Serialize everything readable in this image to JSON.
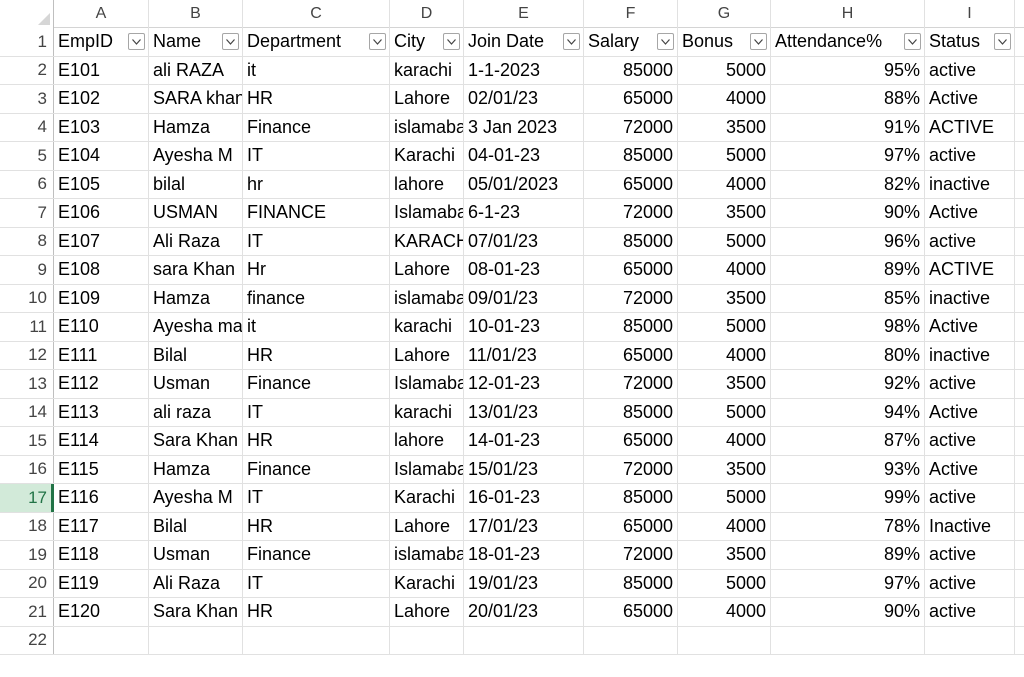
{
  "columns": [
    "A",
    "B",
    "C",
    "D",
    "E",
    "F",
    "G",
    "H",
    "I"
  ],
  "row_numbers": [
    "1",
    "2",
    "3",
    "4",
    "5",
    "6",
    "7",
    "8",
    "9",
    "10",
    "11",
    "12",
    "13",
    "14",
    "15",
    "16",
    "17",
    "18",
    "19",
    "20",
    "21",
    "22"
  ],
  "headers": [
    "EmpID",
    "Name",
    "Department",
    "City",
    "Join Date",
    "Salary",
    "Bonus",
    "Attendance%",
    "Status"
  ],
  "rows": [
    [
      "E101",
      "ali RAZA",
      "it",
      "karachi",
      "1-1-2023",
      "85000",
      "5000",
      "95%",
      "active"
    ],
    [
      "E102",
      " SARA khan",
      "HR",
      "Lahore",
      "02/01/23",
      "65000",
      "4000",
      "88%",
      "Active"
    ],
    [
      "E103",
      "Hamza",
      "Finance",
      "islamabad",
      "3 Jan 2023",
      "72000",
      "3500",
      "91%",
      "ACTIVE"
    ],
    [
      "E104",
      "Ayesha M",
      "IT",
      "Karachi",
      "04-01-23",
      "85000",
      "5000",
      "97%",
      "active"
    ],
    [
      "E105",
      "bilal",
      "hr",
      "lahore",
      "05/01/2023",
      "65000",
      "4000",
      "82%",
      "inactive"
    ],
    [
      "E106",
      "USMAN",
      "FINANCE",
      "Islamabad",
      "6-1-23",
      "72000",
      "3500",
      "90%",
      "Active"
    ],
    [
      "E107",
      "Ali Raza",
      "IT",
      "KARACHI",
      "07/01/23",
      "85000",
      "5000",
      "96%",
      "active"
    ],
    [
      "E108",
      "sara Khan",
      "Hr",
      "Lahore",
      "08-01-23",
      "65000",
      "4000",
      "89%",
      "ACTIVE"
    ],
    [
      "E109",
      "Hamza",
      "finance",
      "islamabad",
      "09/01/23",
      "72000",
      "3500",
      "85%",
      "inactive"
    ],
    [
      "E110",
      "Ayesha malik",
      "it",
      "karachi",
      "10-01-23",
      "85000",
      "5000",
      "98%",
      "Active"
    ],
    [
      "E111",
      "Bilal",
      "HR",
      "Lahore",
      "11/01/23",
      "65000",
      "4000",
      "80%",
      "inactive"
    ],
    [
      "E112",
      "Usman",
      "Finance",
      "Islamabad",
      "12-01-23",
      "72000",
      "3500",
      "92%",
      "active"
    ],
    [
      "E113",
      " ali raza",
      "IT",
      "karachi",
      "13/01/23",
      "85000",
      "5000",
      "94%",
      "Active"
    ],
    [
      "E114",
      "Sara Khan",
      "HR",
      "lahore",
      "14-01-23",
      "65000",
      "4000",
      "87%",
      "active"
    ],
    [
      "E115",
      "Hamza",
      "Finance",
      "Islamabad",
      "15/01/23",
      "72000",
      "3500",
      "93%",
      "Active"
    ],
    [
      "E116",
      "Ayesha M",
      "IT",
      "Karachi",
      "16-01-23",
      "85000",
      "5000",
      "99%",
      "active"
    ],
    [
      "E117",
      "Bilal",
      "HR",
      "Lahore",
      "17/01/23",
      "65000",
      "4000",
      "78%",
      "Inactive"
    ],
    [
      "E118",
      "Usman",
      "Finance",
      "islamabad",
      "18-01-23",
      "72000",
      "3500",
      "89%",
      "active"
    ],
    [
      "E119",
      "Ali Raza",
      "IT",
      "Karachi",
      "19/01/23",
      "85000",
      "5000",
      "97%",
      "active"
    ],
    [
      "E120",
      "Sara Khan",
      "HR",
      "Lahore",
      "20/01/23",
      "65000",
      "4000",
      "90%",
      "active"
    ]
  ],
  "selected_row": "17",
  "colors": {
    "selection_accent": "#217346",
    "selection_fill": "#d2ead9",
    "gridline": "#e1e1e1"
  },
  "icons": {
    "filter": "chevron-down-icon"
  }
}
